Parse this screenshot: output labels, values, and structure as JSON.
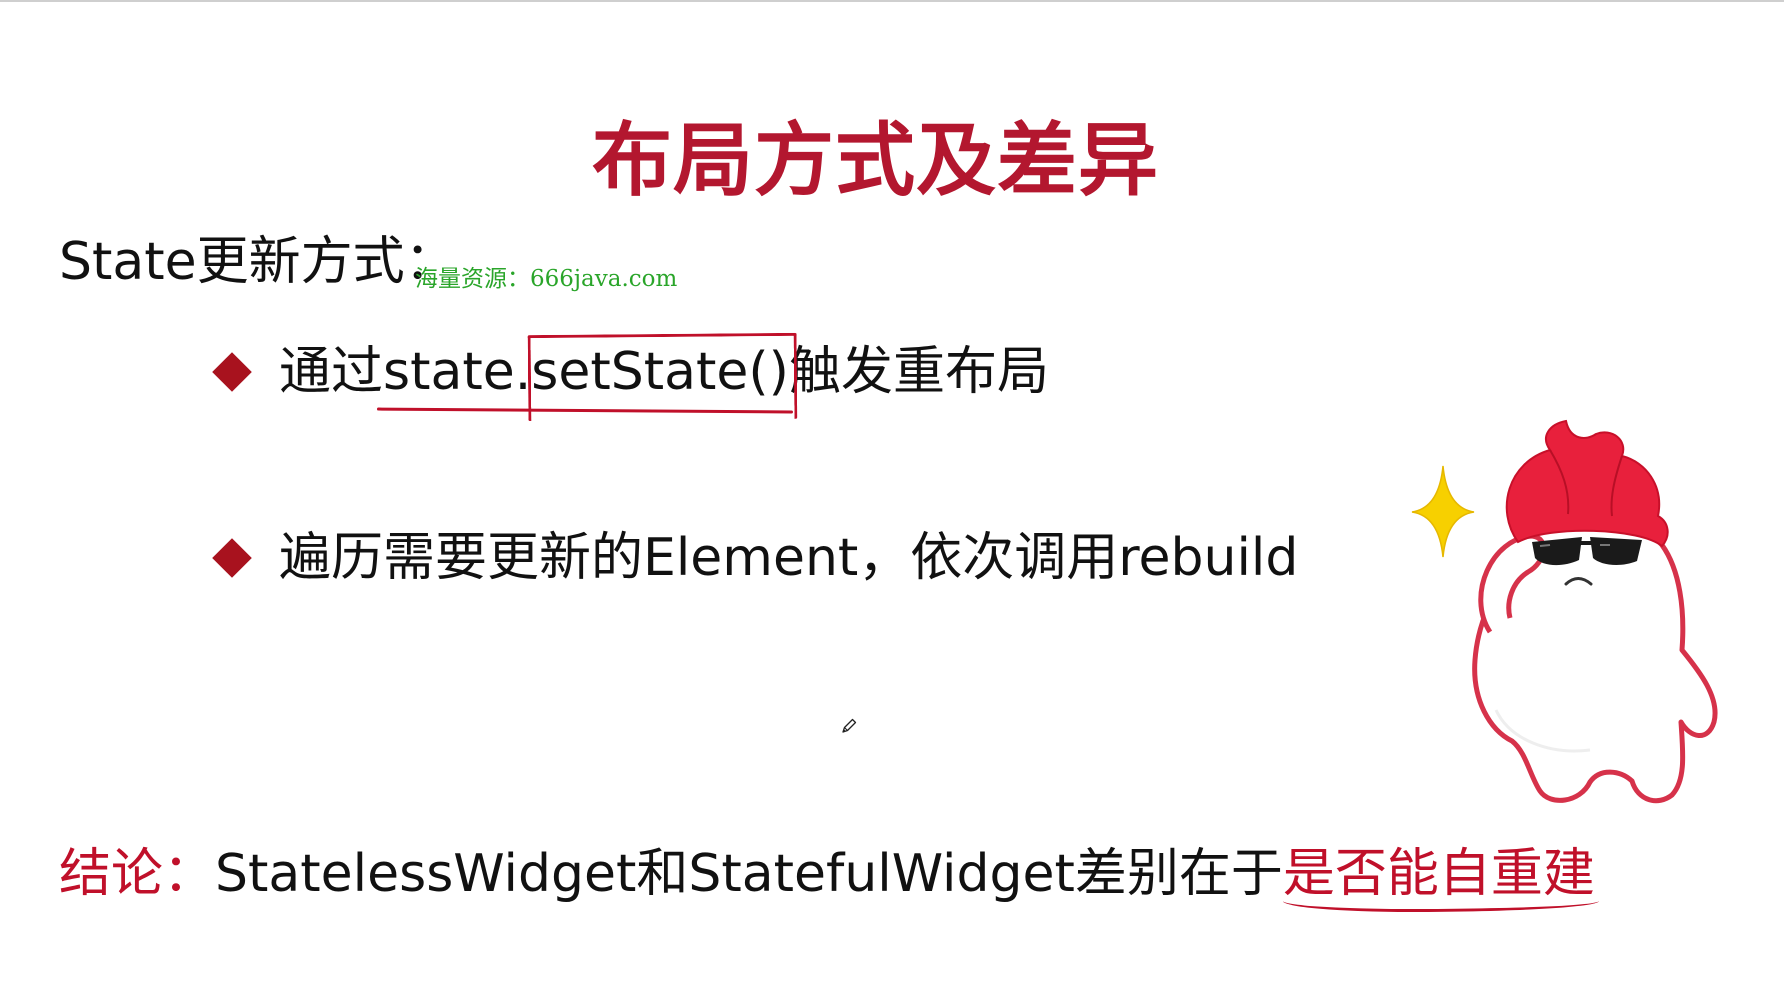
{
  "slide": {
    "title": "布局方式及差异",
    "section_heading": "State更新方式：",
    "watermark": "海量资源：666java.com",
    "bullets": [
      {
        "prefix": "通过",
        "underlined": "state.",
        "boxed": "setState()",
        "suffix": "触发重布局"
      },
      {
        "text": "遍历需要更新的Element，依次调用rebuild"
      }
    ],
    "conclusion": {
      "label": "结论：",
      "body": "StatelessWidget和StatefulWidget差别在于",
      "emphasis": "是否能自重建"
    }
  },
  "colors": {
    "title": "#b3172f",
    "accent": "#c0102a",
    "bullet": "#a8121e",
    "watermark": "#2aa52a",
    "text": "#111111",
    "mascot_outline": "#d6324a",
    "sparkle": "#f7d000"
  },
  "icons": {
    "bullet": "diamond-icon",
    "cursor": "pencil-cursor-icon",
    "mascot": "sunglasses-mascot-icon",
    "sparkle": "sparkle-icon"
  }
}
